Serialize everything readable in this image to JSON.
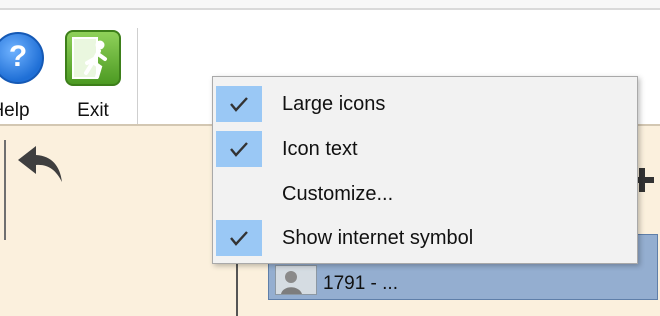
{
  "toolbar": {
    "help_label": "Help",
    "help_icon": "help-icon",
    "exit_label": "Exit",
    "exit_icon": "exit-door-icon"
  },
  "content": {
    "undo_icon": "undo-arrow-icon",
    "expand_icon": "plus-icon",
    "node": {
      "photo_icon": "person-photo-icon",
      "text": "1791 - ..."
    }
  },
  "context_menu": {
    "items": [
      {
        "label": "Large icons",
        "checked": true
      },
      {
        "label": "Icon text",
        "checked": true
      },
      {
        "label": "Customize...",
        "checked": false
      },
      {
        "label": "Show internet symbol",
        "checked": true
      }
    ]
  },
  "colors": {
    "check_highlight": "#9ac8f5",
    "node_background": "#94aed0",
    "content_background": "#fbf0dd",
    "menu_background": "#f2f2f2"
  }
}
